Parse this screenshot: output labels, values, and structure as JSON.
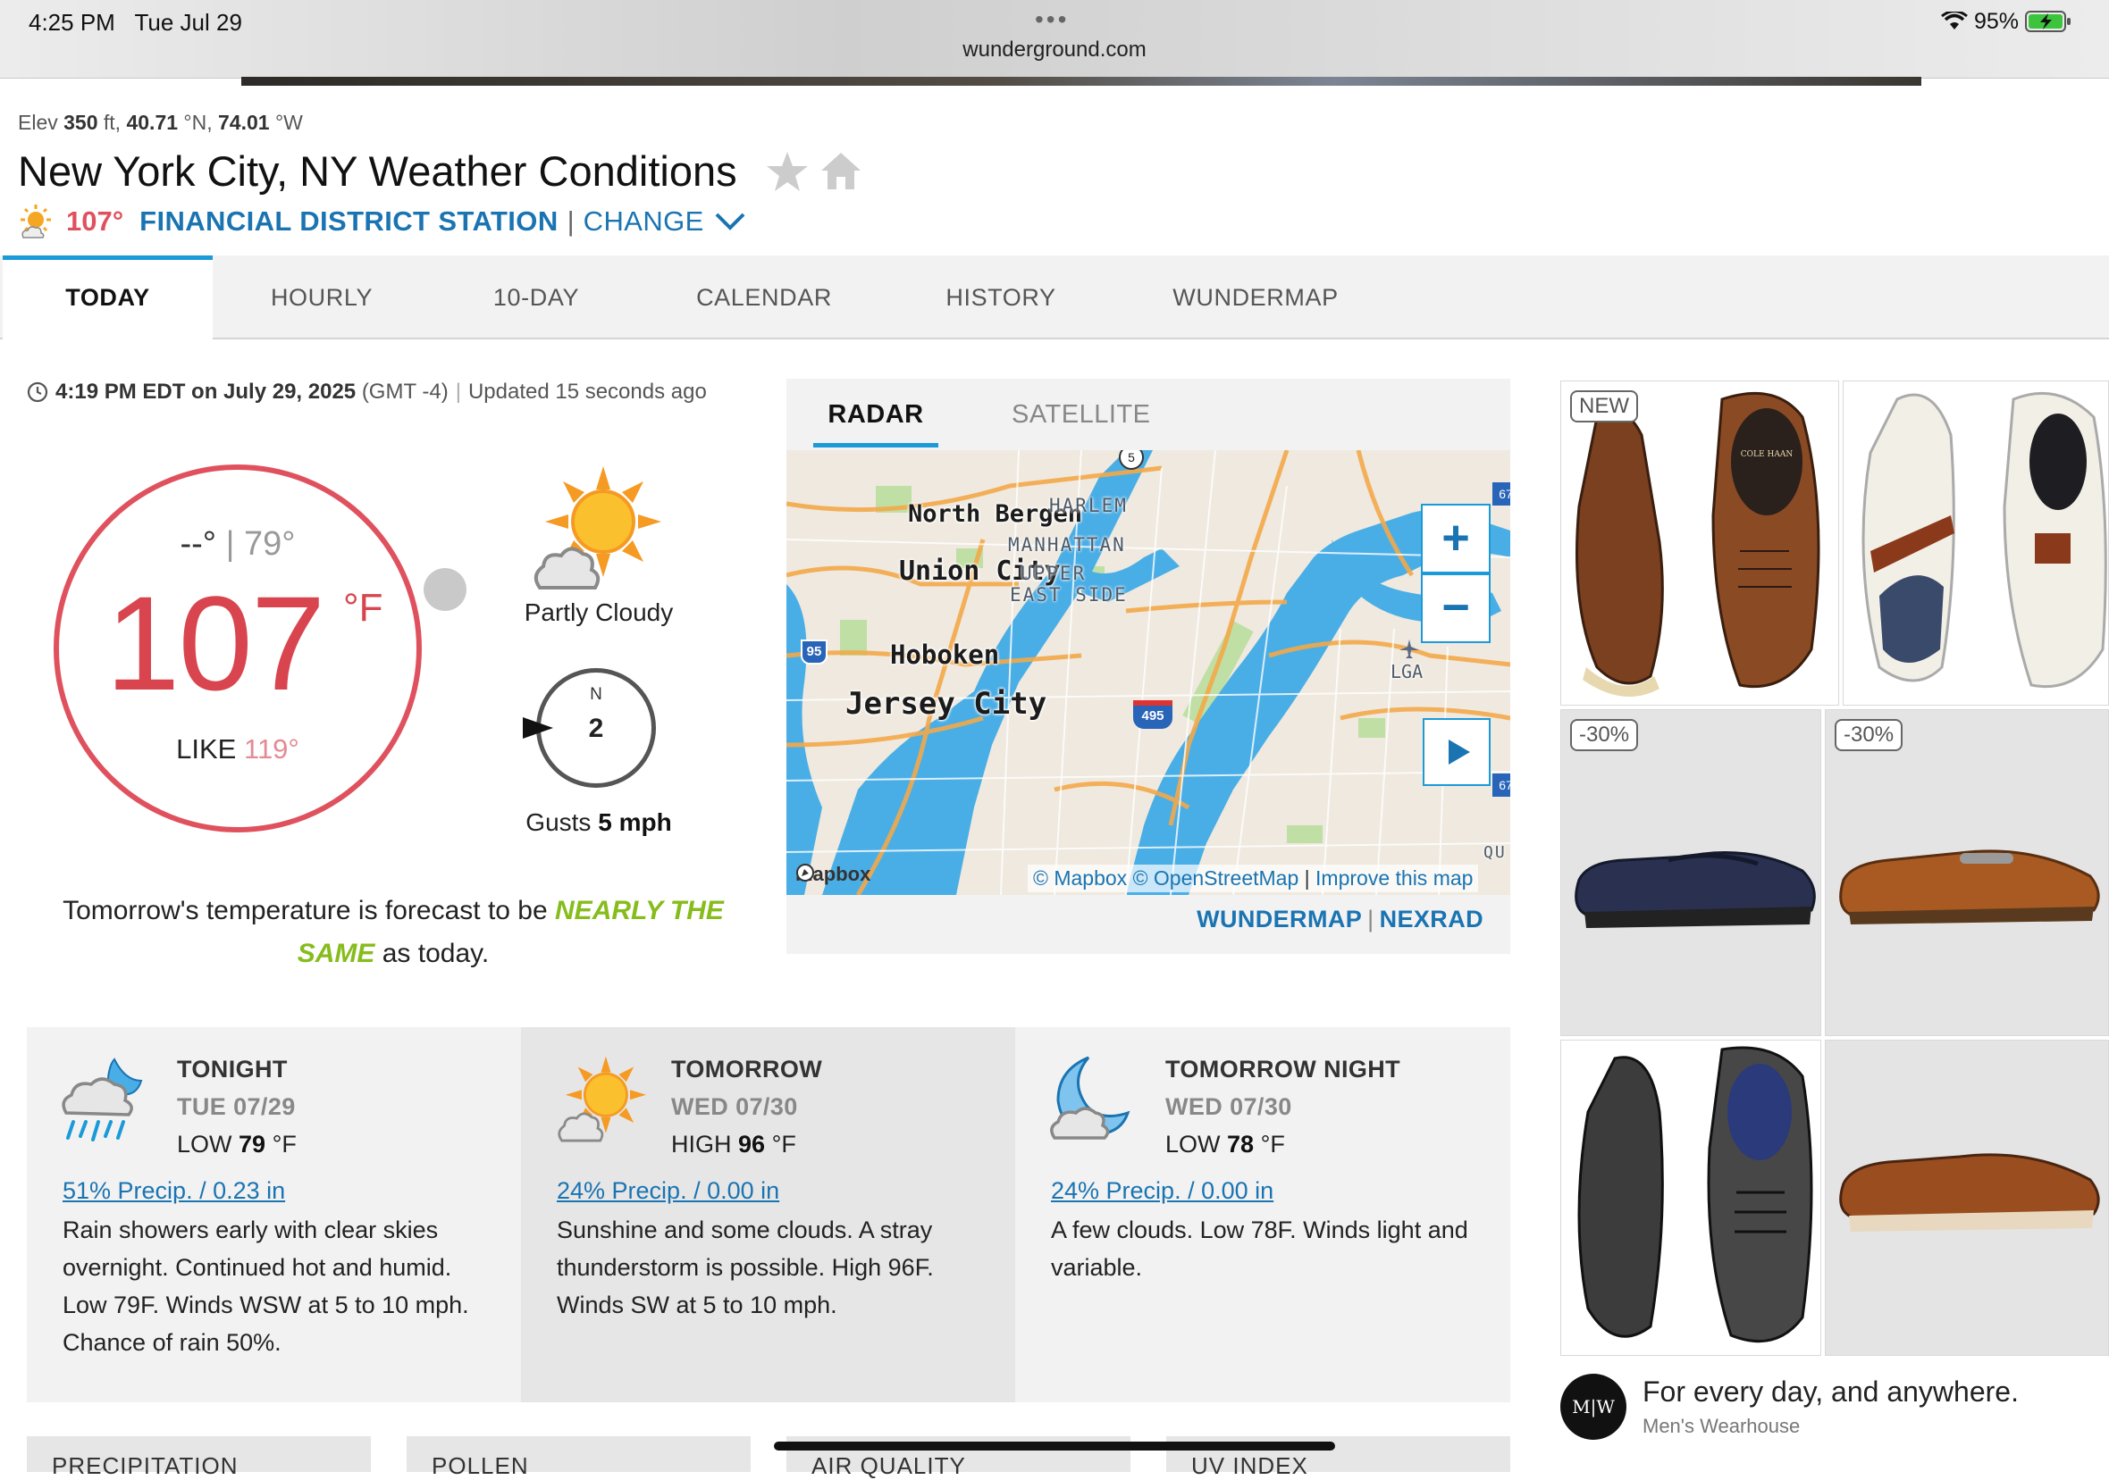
{
  "status_bar": {
    "time": "4:25 PM",
    "date": "Tue Jul 29",
    "url": "wunderground.com",
    "battery": "95%"
  },
  "location": {
    "elev_label": "Elev",
    "elev_value": "350",
    "elev_unit": "ft,",
    "lat_value": "40.71",
    "lat_unit": "°N,",
    "lon_value": "74.01",
    "lon_unit": "°W",
    "title": "New York City, NY Weather Conditions",
    "station_temp": "107°",
    "station_name": "FINANCIAL DISTRICT STATION",
    "change_label": "CHANGE"
  },
  "nav_tabs": [
    "TODAY",
    "HOURLY",
    "10-DAY",
    "CALENDAR",
    "HISTORY",
    "WUNDERMAP"
  ],
  "current": {
    "timestamp": "4:19 PM EDT on July 29, 2025",
    "tz": "(GMT -4)",
    "updated": "Updated 15 seconds ago",
    "low": "--°",
    "high": "79°",
    "temp": "107",
    "unit": "°F",
    "feels_like_label": "LIKE",
    "feels_like": "119°",
    "condition": "Partly Cloudy",
    "wind_dir": "N",
    "wind_speed": "2",
    "gusts_label": "Gusts",
    "gusts_value": "5 mph",
    "note_pre": "Tomorrow's temperature is forecast to be",
    "note_hl": "NEARLY THE SAME",
    "note_post": "as today."
  },
  "map": {
    "tabs": [
      "RADAR",
      "SATELLITE"
    ],
    "labels": {
      "north_bergen": "North Bergen",
      "union_city": "Union City",
      "hoboken": "Hoboken",
      "jersey_city": "Jersey City",
      "harlem": "HARLEM",
      "manhattan": "MANHATTAN",
      "upper": "UPPER",
      "east_side": "EAST SIDE",
      "lga": "LGA",
      "qu": "QU"
    },
    "shields": {
      "i95": "95",
      "i495": "495",
      "r5": "5",
      "r67": "67"
    },
    "zoom_in": "+",
    "zoom_out": "−",
    "mapbox_logo": "mapbox",
    "attrib_mapbox": "© Mapbox",
    "attrib_osm": "© OpenStreetMap",
    "attrib_sep": "|",
    "attrib_improve": "Improve this map",
    "link_wundermap": "WUNDERMAP",
    "link_sep": "|",
    "link_nexrad": "NEXRAD"
  },
  "forecast_cards": [
    {
      "title": "TONIGHT",
      "date": "TUE 07/29",
      "temp_label": "LOW",
      "temp": "79",
      "unit": "°F",
      "precip": "51% Precip. / 0.23 in",
      "desc": "Rain showers early with clear skies overnight. Continued hot and humid. Low 79F. Winds WSW at 5 to 10 mph. Chance of rain 50%."
    },
    {
      "title": "TOMORROW",
      "date": "WED 07/30",
      "temp_label": "HIGH",
      "temp": "96",
      "unit": "°F",
      "precip": "24% Precip. / 0.00 in",
      "desc": "Sunshine and some clouds. A stray thunderstorm is possible. High 96F. Winds SW at 5 to 10 mph."
    },
    {
      "title": "TOMORROW NIGHT",
      "date": "WED 07/30",
      "temp_label": "LOW",
      "temp": "78",
      "unit": "°F",
      "precip": "24% Precip. / 0.00 in",
      "desc": "A few clouds. Low 78F. Winds light and variable."
    }
  ],
  "sub_tabs": [
    "PRECIPITATION",
    "POLLEN",
    "AIR QUALITY",
    "UV INDEX"
  ],
  "ad": {
    "badge_new": "NEW",
    "badge_off1": "-30%",
    "badge_off2": "-30%",
    "shoe_brand_print": "COLE HAAN",
    "logo": "M|W",
    "tagline": "For every day, and anywhere.",
    "brand": "Men's Wearhouse"
  },
  "colors": {
    "accent_blue": "#1a74b2",
    "tab_blue": "#1a9ad8",
    "temp_red": "#d9454f",
    "highlight_green": "#86bc1c"
  }
}
